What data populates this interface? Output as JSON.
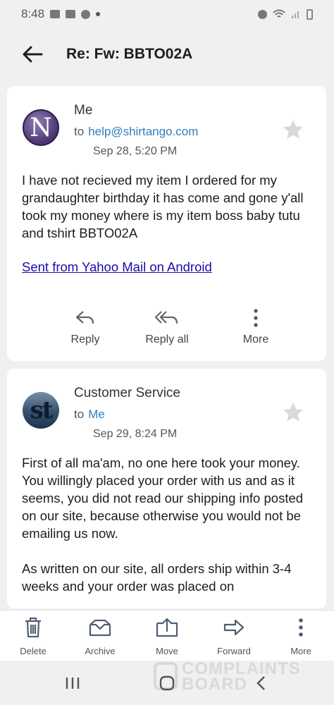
{
  "status_bar": {
    "time": "8:48"
  },
  "header": {
    "title": "Re: Fw: BBTO02A"
  },
  "messages": [
    {
      "sender": "Me",
      "to_label": "to",
      "to": "help@shirtango.com",
      "date": "Sep 28, 5:20 PM",
      "avatar_letter": "N",
      "body": "I have not recieved my item I ordered for my grandaughter birthday it has come and gone y'all took my money where is my item boss baby tutu and tshirt BBTO02A",
      "signature_link": "Sent from Yahoo Mail on Android"
    },
    {
      "sender": "Customer Service",
      "to_label": "to",
      "to": "Me",
      "date": "Sep 29, 8:24 PM",
      "avatar_letter": "st",
      "body": [
        "First of all ma'am, no one here took your money. You willingly placed your order with us and as it seems, you did not read our shipping info posted on our site, because otherwise you would not be emailing us now.",
        "As written on our site, all orders ship within 3-4 weeks and your order was placed on"
      ]
    }
  ],
  "message_actions": {
    "reply": "Reply",
    "reply_all": "Reply all",
    "more": "More"
  },
  "bottom_bar": {
    "delete": "Delete",
    "archive": "Archive",
    "move": "Move",
    "forward": "Forward",
    "more": "More"
  },
  "watermark": {
    "line1": "COMPLAINTS",
    "line2": "BOARD"
  },
  "colors": {
    "link": "#2f7fc0",
    "background": "#f0f0f2",
    "card": "#ffffff"
  }
}
